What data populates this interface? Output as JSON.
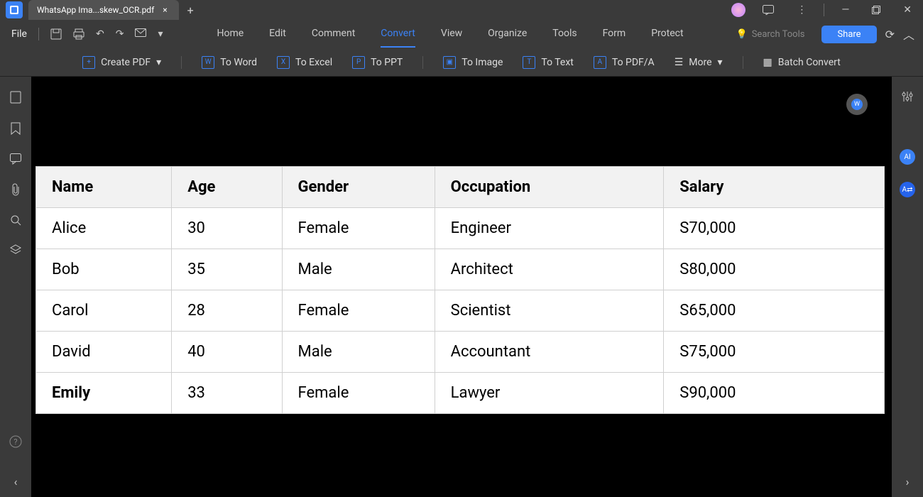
{
  "tab_title": "WhatsApp Ima...skew_OCR.pdf",
  "file_label": "File",
  "menu": {
    "home": "Home",
    "edit": "Edit",
    "comment": "Comment",
    "convert": "Convert",
    "view": "View",
    "organize": "Organize",
    "tools": "Tools",
    "form": "Form",
    "protect": "Protect"
  },
  "search_placeholder": "Search Tools",
  "share_label": "Share",
  "toolbar": {
    "create": "Create PDF",
    "to_word": "To Word",
    "to_excel": "To Excel",
    "to_ppt": "To PPT",
    "to_image": "To Image",
    "to_text": "To Text",
    "to_pdfa": "To PDF/A",
    "more": "More",
    "batch": "Batch Convert"
  },
  "table": {
    "headers": [
      "Name",
      "Age",
      "Gender",
      "Occupation",
      "Salary"
    ],
    "rows": [
      [
        "Alice",
        "30",
        "Female",
        "Engineer",
        "S70,000"
      ],
      [
        "Bob",
        "35",
        "Male",
        "Architect",
        "S80,000"
      ],
      [
        "Carol",
        "28",
        "Female",
        "Scientist",
        "S65,000"
      ],
      [
        "David",
        "40",
        "Male",
        "Accountant",
        "S75,000"
      ],
      [
        "Emily",
        "33",
        "Female",
        "Lawyer",
        "S90,000"
      ]
    ]
  }
}
